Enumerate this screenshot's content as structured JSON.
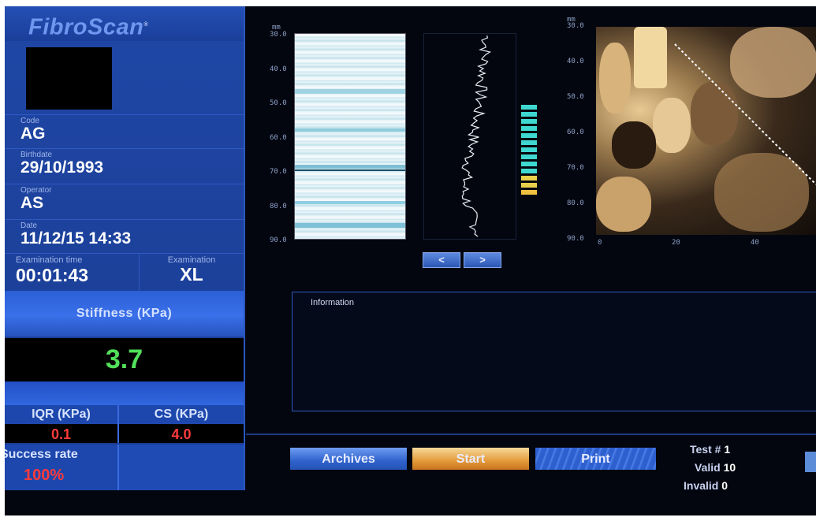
{
  "brand": {
    "name": "FibroScan",
    "mark": "®"
  },
  "patient": {
    "code_label": "Code",
    "code": "AG",
    "birthdate_label": "Birthdate",
    "birthdate": "29/10/1993",
    "operator_label": "Operator",
    "operator": "AS",
    "date_label": "Date",
    "date": "11/12/15 14:33"
  },
  "examination": {
    "time_label": "Examination time",
    "time": "00:01:43",
    "probe_label": "Examination",
    "probe": "XL"
  },
  "results": {
    "stiffness_label": "Stiffness (KPa)",
    "stiffness": "3.7",
    "iqr_label": "IQR (KPa)",
    "iqr": "0.1",
    "cs_label": "CS (KPa)",
    "cs": "4.0",
    "success_label": "Success rate",
    "success": "100%"
  },
  "mmode": {
    "unit": "mm",
    "depth_ticks": [
      "30.0",
      "40.0",
      "50.0",
      "60.0",
      "70.0",
      "80.0",
      "90.0"
    ]
  },
  "ultrasound": {
    "unit": "mm",
    "depth_ticks": [
      "30.0",
      "40.0",
      "50.0",
      "60.0",
      "70.0",
      "80.0",
      "90.0"
    ],
    "x_ticks": [
      "0",
      "20",
      "40"
    ]
  },
  "nav": {
    "prev": "<",
    "next": ">"
  },
  "info": {
    "label": "Information"
  },
  "buttons": {
    "archives": "Archives",
    "start": "Start",
    "print": "Print"
  },
  "counts": {
    "test_label": "Test #",
    "test": "1",
    "valid_label": "Valid",
    "valid": "10",
    "invalid_label": "Invalid",
    "invalid": "0"
  },
  "colors": {
    "panel_blue": "#1a3c92",
    "stiffness_green": "#52e05a",
    "result_red": "#ff3b3b",
    "start_orange": "#e49a3a",
    "indicator_cyan": "#3fd8d0",
    "indicator_yellow": "#e8d04a"
  },
  "quality_bars": {
    "count": 13
  }
}
